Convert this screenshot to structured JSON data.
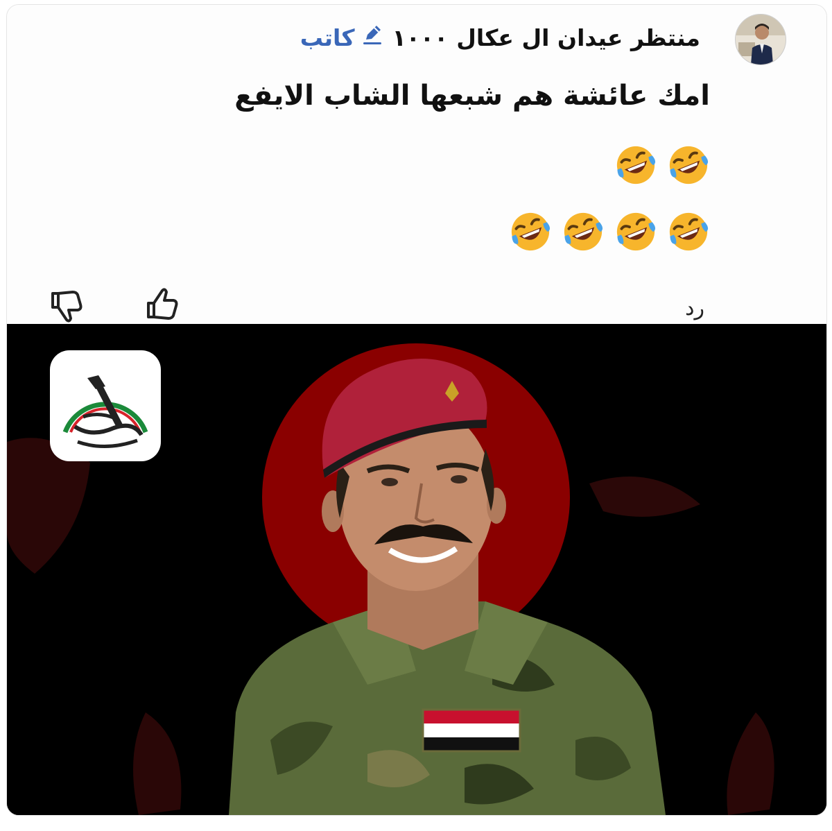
{
  "comment": {
    "username": "منتظر عيدان ال عكال",
    "points": "١٠٠٠",
    "badge_label": "كاتب",
    "badge_icon": "pencil-icon",
    "text": "امك عائشة هم شبعها الشاب الايفع",
    "emoji_rows": [
      [
        "rolling-laughing-emoji",
        "rolling-laughing-emoji"
      ],
      [
        "rolling-laughing-emoji",
        "rolling-laughing-emoji",
        "rolling-laughing-emoji",
        "rolling-laughing-emoji"
      ]
    ],
    "reply_label": "رد"
  },
  "actions": {
    "like_icon": "thumbs-up-icon",
    "dislike_icon": "thumbs-down-icon"
  },
  "photo": {
    "logo_icon": "hashd-emblem-icon",
    "colors": {
      "background": "#000000",
      "halo": "#8a0000",
      "beret": "#b0213a"
    }
  }
}
